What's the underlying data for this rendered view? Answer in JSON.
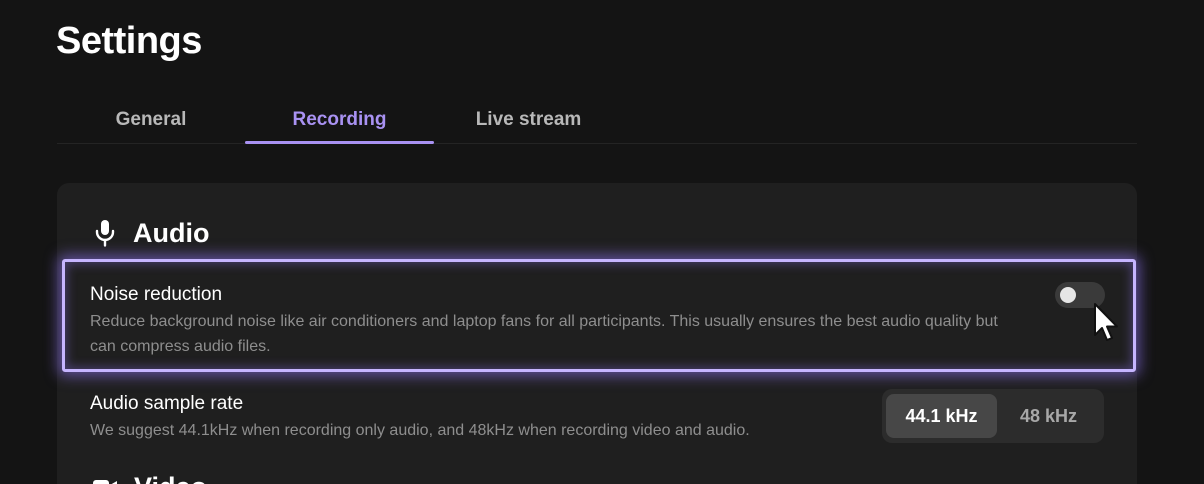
{
  "page": {
    "title": "Settings"
  },
  "tabs": [
    {
      "label": "General",
      "active": false
    },
    {
      "label": "Recording",
      "active": true
    },
    {
      "label": "Live stream",
      "active": false
    }
  ],
  "audio_section": {
    "icon": "microphone-icon",
    "title": "Audio",
    "noise_reduction": {
      "label": "Noise reduction",
      "description": "Reduce background noise like air conditioners and laptop fans for all participants. This usually ensures the best audio quality but can compress audio files.",
      "enabled": false
    },
    "sample_rate": {
      "label": "Audio sample rate",
      "description": "We suggest 44.1kHz when recording only audio, and 48kHz when recording video and audio.",
      "options": [
        "44.1 kHz",
        "48 kHz"
      ],
      "selected": "44.1 kHz"
    }
  },
  "next_section": {
    "icon": "video-camera-icon",
    "title": "Video"
  },
  "colors": {
    "accent": "#a992f2",
    "highlight": "#c6b5ff",
    "background": "#141414",
    "card": "#1f1f1f"
  }
}
